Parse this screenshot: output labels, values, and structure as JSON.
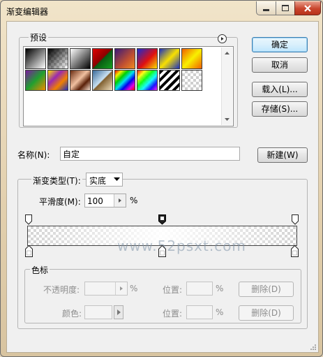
{
  "window": {
    "title": "渐变编辑器",
    "controls": [
      "minimize-icon",
      "maximize-icon",
      "close-icon"
    ]
  },
  "presets": {
    "legend": "预设",
    "menu_icon": "arrow-right-circle-icon",
    "swatches": [
      "black-white",
      "black-transparent",
      "black-white-reversed",
      "red-green",
      "violet-orange",
      "blue-red-yellow",
      "blue-yellow-blue",
      "orange-yellow-orange",
      "violet-green-orange",
      "yellow-violet-orange-blue",
      "copper",
      "chrome",
      "spectrum",
      "transparent-rainbow",
      "transparent-stripes",
      "checker-transparent"
    ]
  },
  "buttons": {
    "ok": "确定",
    "cancel": "取消",
    "load": "载入(L)...",
    "save": "存储(S)...",
    "new": "新建(W)"
  },
  "name": {
    "label": "名称(N):",
    "value": "自定"
  },
  "gradient": {
    "type_label": "渐变类型(T):",
    "type_value": "实底",
    "smoothness_label": "平滑度(M):",
    "smoothness_value": "100",
    "smoothness_unit": "%"
  },
  "watermark": "www.52psxt.com",
  "color_stops": {
    "legend": "色标",
    "opacity_label": "不透明度:",
    "opacity_unit": "%",
    "location_label": "位置:",
    "location_unit": "%",
    "color_label": "颜色:",
    "delete_label": "删除(D)"
  },
  "colors": {
    "accent": "#3c7fb1",
    "close_button": "#c9452c"
  }
}
